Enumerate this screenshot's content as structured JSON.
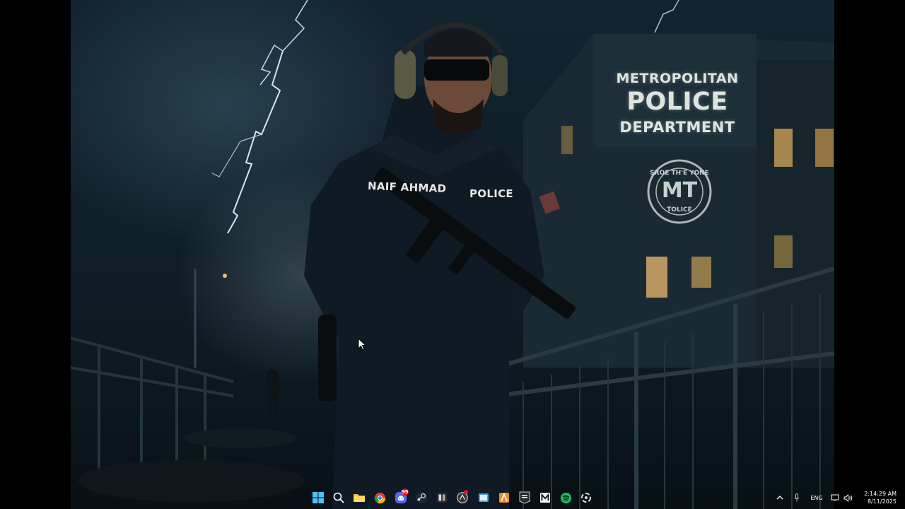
{
  "wallpaper": {
    "sign": {
      "line1": "METROPOLITAN",
      "line2": "POLICE",
      "line3": "DEPARTMENT"
    },
    "emblem": {
      "top": "SROE TH'E YONE",
      "initials": "MT",
      "bottom": "TOLICE"
    },
    "uniform": {
      "name_patch": "NAIF AHMAD",
      "chest_patch": "POLICE"
    }
  },
  "taskbar": {
    "pinned": [
      {
        "name": "start-button",
        "icon": "windows-icon"
      },
      {
        "name": "search-button",
        "icon": "search-icon"
      },
      {
        "name": "file-explorer-button",
        "icon": "folder-icon"
      },
      {
        "name": "chrome-button",
        "icon": "chrome-icon"
      },
      {
        "name": "discord-button",
        "icon": "discord-icon",
        "badge": "99"
      },
      {
        "name": "steam-button",
        "icon": "steam-icon"
      },
      {
        "name": "app-button-bm",
        "icon": "app-icon"
      },
      {
        "name": "app-button-circle",
        "icon": "circle-app-icon"
      },
      {
        "name": "app-button-blue",
        "icon": "window-icon"
      },
      {
        "name": "app-button-orange",
        "icon": "a-icon"
      },
      {
        "name": "epic-games-button",
        "icon": "epic-icon"
      },
      {
        "name": "app-button-m",
        "icon": "m-icon"
      },
      {
        "name": "spotify-button",
        "icon": "spotify-icon"
      },
      {
        "name": "app-button-ring",
        "icon": "ring-icon"
      }
    ],
    "tray": {
      "language": "ENG",
      "time": "2:14:29 AM",
      "date": "8/11/2025"
    }
  },
  "colors": {
    "taskbar_text": "#ffffff",
    "badge": "#e81123",
    "spotify": "#1db954"
  }
}
